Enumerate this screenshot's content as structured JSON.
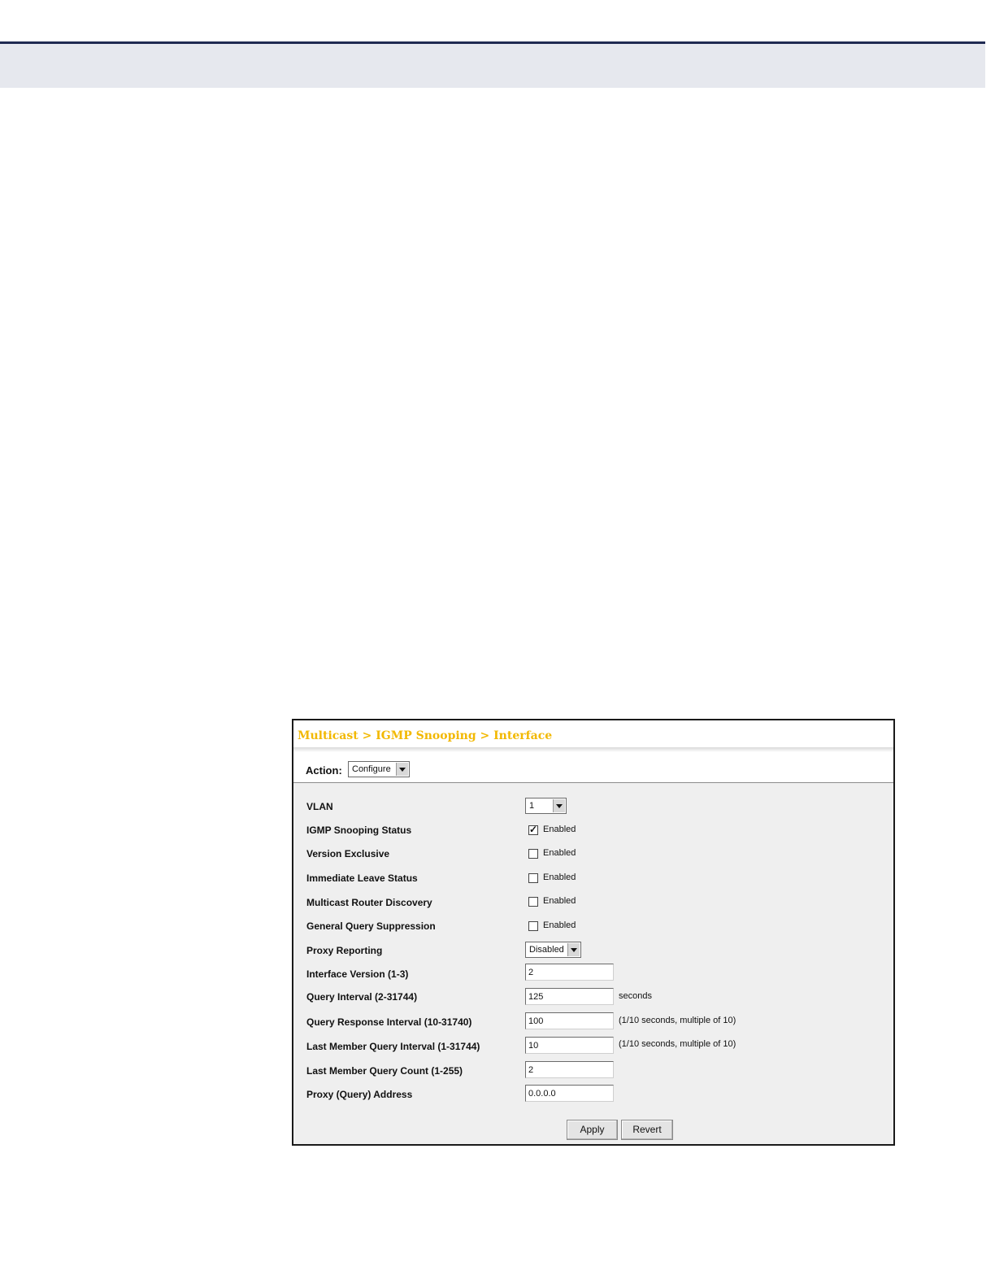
{
  "breadcrumb": "Multicast > IGMP Snooping > Interface",
  "action": {
    "label": "Action:",
    "value": "Configure"
  },
  "vlan": {
    "label": "VLAN",
    "value": "1"
  },
  "checks": [
    {
      "label": "IGMP Snooping Status",
      "text": "Enabled",
      "checked": true
    },
    {
      "label": "Version Exclusive",
      "text": "Enabled",
      "checked": false
    },
    {
      "label": "Immediate Leave Status",
      "text": "Enabled",
      "checked": false
    },
    {
      "label": "Multicast Router Discovery",
      "text": "Enabled",
      "checked": false
    },
    {
      "label": "General Query Suppression",
      "text": "Enabled",
      "checked": false
    }
  ],
  "proxy_reporting": {
    "label": "Proxy Reporting",
    "value": "Disabled"
  },
  "fields": [
    {
      "label": "Interface Version (1-3)",
      "value": "2",
      "hint": ""
    },
    {
      "label": "Query Interval (2-31744)",
      "value": "125",
      "hint": "seconds"
    },
    {
      "label": "Query Response Interval (10-31740)",
      "value": "100",
      "hint": "(1/10 seconds, multiple of 10)"
    },
    {
      "label": "Last Member Query Interval (1-31744)",
      "value": "10",
      "hint": "(1/10 seconds, multiple of 10)"
    },
    {
      "label": "Last Member Query Count (1-255)",
      "value": "2",
      "hint": ""
    },
    {
      "label": "Proxy (Query) Address",
      "value": "0.0.0.0",
      "hint": ""
    }
  ],
  "buttons": {
    "apply": "Apply",
    "revert": "Revert"
  }
}
